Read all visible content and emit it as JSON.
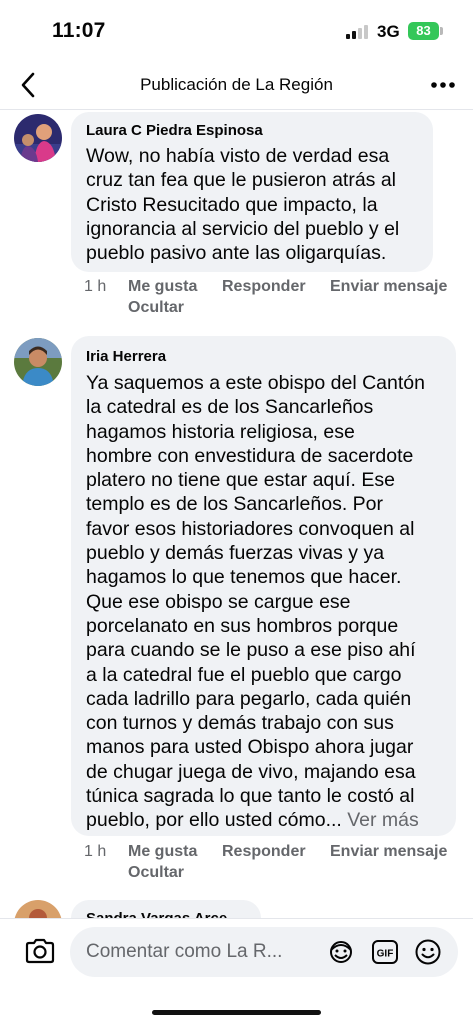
{
  "status_bar": {
    "time": "11:07",
    "network": "3G",
    "battery": "83"
  },
  "header": {
    "title": "Publicación de La Región",
    "back_icon": "chevron-left-icon",
    "more_icon": "more-horizontal-icon"
  },
  "comments": [
    {
      "author": "Laura C Piedra Espinosa",
      "lines": [
        "Wow, no había visto de verdad esa",
        "cruz tan fea que le pusieron atrás al",
        "Cristo Resucitado que impacto, la",
        "ignorancia al servicio del pueblo y el",
        "pueblo pasivo ante las oligarquías."
      ],
      "time": "1 h",
      "like": "Me gusta",
      "reply": "Responder",
      "send": "Enviar mensaje",
      "hide": "Ocultar"
    },
    {
      "author": "Iria Herrera",
      "lines": [
        "Ya saquemos a este obispo del Cantón",
        "la catedral es de los Sancarleños",
        "hagamos historia religiosa, ese",
        "hombre con envestidura de sacerdote",
        "platero no tiene que estar aquí. Ese",
        "templo es de los Sancarleños. Por",
        "favor esos historiadores convoquen al",
        "pueblo y demás fuerzas vivas y ya",
        "hagamos lo que tenemos que hacer.",
        "Que ese obispo se cargue ese",
        "porcelanato en sus hombros porque",
        "para cuando se le puso a ese piso ahí",
        "a la catedral fue el pueblo que cargo",
        "cada ladrillo para pegarlo, cada quién",
        "con turnos y demás trabajo con sus",
        "manos para usted Obispo ahora jugar",
        "de chugar juega de vivo, majando esa",
        "túnica sagrada lo que tanto le costó al",
        "pueblo, por ello usted cómo..."
      ],
      "see_more": "Ver más",
      "time": "1 h",
      "like": "Me gusta",
      "reply": "Responder",
      "send": "Enviar mensaje",
      "hide": "Ocultar"
    },
    {
      "author": "Sandra Vargas Arce"
    }
  ],
  "composer": {
    "placeholder": "Comentar como La R...",
    "camera_icon": "camera-icon",
    "avatar_icon": "avatar-sticker-icon",
    "gif_label": "GIF",
    "emoji_icon": "emoji-icon"
  }
}
